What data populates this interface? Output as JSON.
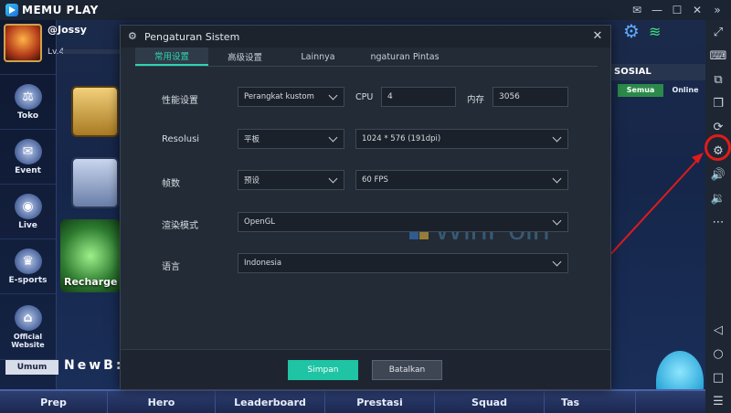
{
  "emulator": {
    "logo_text": "MEMU PLAY",
    "window_controls": [
      "✉",
      "—",
      "☐",
      "✕",
      "»"
    ]
  },
  "game": {
    "player_name": "@Jossy",
    "level": "Lv.4",
    "left_nav": [
      "Toko",
      "Event",
      "Live",
      "E-sports",
      "Official Website"
    ],
    "recharge_label": "Recharge Gi",
    "social_header": "SOSIAL",
    "social_tabs": {
      "all": "Semua",
      "online": "Online"
    },
    "chat_channel": "Umum",
    "chat_preview": "NewB:",
    "bottom_nav": [
      "Prep",
      "Hero",
      "Leaderboard",
      "Prestasi",
      "Squad",
      "Tas"
    ]
  },
  "dialog": {
    "title": "Pengaturan Sistem",
    "tabs": [
      "常用设置",
      "高级设置",
      "Lainnya",
      "ngaturan Pintas"
    ],
    "active_tab": 0,
    "rows": {
      "performance": {
        "label": "性能设置",
        "preset": "Perangkat kustom",
        "cpu_label": "CPU",
        "cpu_value": "4",
        "memory_label": "内存",
        "memory_value": "3056"
      },
      "resolution": {
        "label": "Resolusi",
        "mode": "平板",
        "value": "1024 * 576 (191dpi)"
      },
      "fps": {
        "label": "帧数",
        "mode": "预设",
        "value": "60 FPS"
      },
      "render": {
        "label": "渲染模式",
        "value": "OpenGL"
      },
      "language": {
        "label": "语言",
        "value": "Indonesia"
      }
    },
    "buttons": {
      "save": "Simpan",
      "cancel": "Batalkan"
    }
  },
  "watermark": "WinPoin",
  "colors": {
    "accent": "#1ec4a3",
    "highlight_ring": "#e11b1b",
    "dialog_bg": "#222b36"
  }
}
